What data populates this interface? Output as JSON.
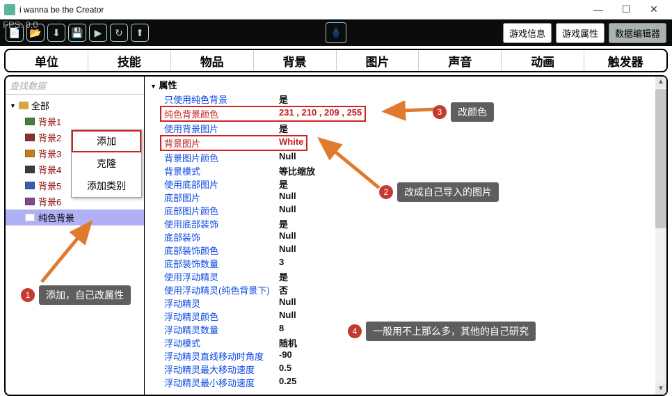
{
  "title": "i wanna be the Creator",
  "fps": "FPS: 0.0",
  "toolbar": {
    "right_buttons": [
      "游戏信息",
      "游戏属性",
      "数据编辑器"
    ],
    "active_right": 2
  },
  "tabs": [
    "单位",
    "技能",
    "物品",
    "背景",
    "图片",
    "声音",
    "动画",
    "触发器"
  ],
  "search_placeholder": "查找数据",
  "tree": {
    "root_label": "全部",
    "items": [
      {
        "label": "背景1",
        "color": "#4a7d3d"
      },
      {
        "label": "背景2",
        "color": "#8b2f2f"
      },
      {
        "label": "背景3",
        "color": "#c77a1f"
      },
      {
        "label": "背景4",
        "color": "#3b3b3b"
      },
      {
        "label": "背景5",
        "color": "#3b5dae"
      },
      {
        "label": "背景6",
        "color": "#7d4a8a"
      },
      {
        "label": "纯色背景",
        "color": "#ffffff",
        "selected": true
      }
    ]
  },
  "context_menu": [
    "添加",
    "克隆",
    "添加类别"
  ],
  "prop_header": "属性",
  "properties": [
    {
      "name": "只使用纯色背景",
      "value": "是"
    },
    {
      "name": "纯色背景颜色",
      "value": "231 , 210 , 209 , 255",
      "hi": true
    },
    {
      "name": "使用背景图片",
      "value": "是"
    },
    {
      "name": "背景图片",
      "value": "White",
      "hi": true
    },
    {
      "name": "背景图片颜色",
      "value": "Null"
    },
    {
      "name": "背景模式",
      "value": "等比缩放"
    },
    {
      "name": "使用底部图片",
      "value": "是"
    },
    {
      "name": "底部图片",
      "value": "Null"
    },
    {
      "name": "底部图片颜色",
      "value": "Null"
    },
    {
      "name": "使用底部装饰",
      "value": "是"
    },
    {
      "name": "底部装饰",
      "value": "Null"
    },
    {
      "name": "底部装饰颜色",
      "value": "Null"
    },
    {
      "name": "底部装饰数量",
      "value": "3"
    },
    {
      "name": "使用浮动精灵",
      "value": "是"
    },
    {
      "name": "使用浮动精灵(纯色背景下)",
      "value": "否"
    },
    {
      "name": "浮动精灵",
      "value": "Null"
    },
    {
      "name": "浮动精灵颜色",
      "value": "Null"
    },
    {
      "name": "浮动精灵数量",
      "value": "8"
    },
    {
      "name": "浮动模式",
      "value": "随机"
    },
    {
      "name": "浮动精灵直线移动时角度",
      "value": "-90"
    },
    {
      "name": "浮动精灵最大移动速度",
      "value": "0.5"
    },
    {
      "name": "浮动精灵最小移动速度",
      "value": "0.25"
    }
  ],
  "annotations": {
    "a1": "添加，自己改属性",
    "a2": "改成自己导入的图片",
    "a3": "改颜色",
    "a4": "一般用不上那么多，其他的自己研究"
  }
}
